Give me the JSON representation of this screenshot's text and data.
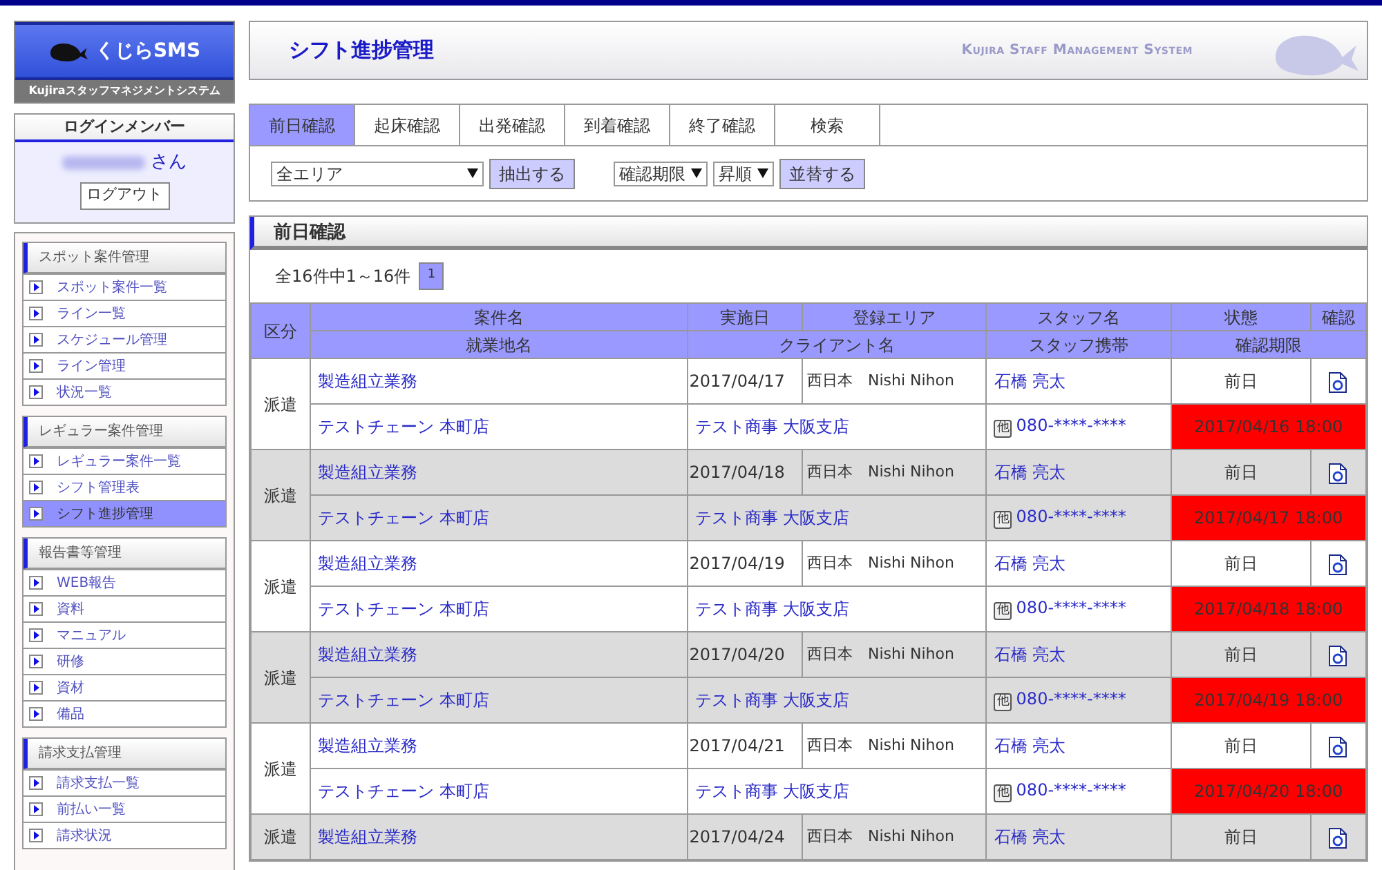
{
  "logo": {
    "title": "くじらSMS",
    "subtitle": "Kujiraスタッフマネジメントシステム"
  },
  "login": {
    "heading": "ログインメンバー",
    "honorific": "さん",
    "logout": "ログアウト"
  },
  "sidebar": [
    {
      "heading": "スポット案件管理",
      "items": [
        {
          "label": "スポット案件一覧",
          "selected": false
        },
        {
          "label": "ライン一覧",
          "selected": false
        },
        {
          "label": "スケジュール管理",
          "selected": false
        },
        {
          "label": "ライン管理",
          "selected": false
        },
        {
          "label": "状況一覧",
          "selected": false
        }
      ]
    },
    {
      "heading": "レギュラー案件管理",
      "items": [
        {
          "label": "レギュラー案件一覧",
          "selected": false
        },
        {
          "label": "シフト管理表",
          "selected": false
        },
        {
          "label": "シフト進捗管理",
          "selected": true
        }
      ]
    },
    {
      "heading": "報告書等管理",
      "items": [
        {
          "label": "WEB報告",
          "selected": false
        },
        {
          "label": "資料",
          "selected": false
        },
        {
          "label": "マニュアル",
          "selected": false
        },
        {
          "label": "研修",
          "selected": false
        },
        {
          "label": "資材",
          "selected": false
        },
        {
          "label": "備品",
          "selected": false
        }
      ]
    },
    {
      "heading": "請求支払管理",
      "items": [
        {
          "label": "請求支払一覧",
          "selected": false
        },
        {
          "label": "前払い一覧",
          "selected": false
        },
        {
          "label": "請求状況",
          "selected": false
        }
      ]
    }
  ],
  "header": {
    "title": "シフト進捗管理",
    "tagline": "Kujira Staff Management System"
  },
  "tabs": [
    {
      "label": "前日確認",
      "selected": true
    },
    {
      "label": "起床確認",
      "selected": false
    },
    {
      "label": "出発確認",
      "selected": false
    },
    {
      "label": "到着確認",
      "selected": false
    },
    {
      "label": "終了確認",
      "selected": false
    },
    {
      "label": "検索",
      "selected": false
    }
  ],
  "filters": {
    "area": "全エリア",
    "extract": "抽出する",
    "sort_key": "確認期限",
    "sort_order": "昇順",
    "sort": "並替する"
  },
  "section": {
    "title": "前日確認",
    "count": "全16件中1～16件",
    "pages": [
      {
        "label": "1",
        "selected": true
      }
    ]
  },
  "table": {
    "header_1": [
      "区分",
      "案件名",
      "実施日",
      "登録エリア",
      "スタッフ名",
      "状態",
      "確認"
    ],
    "header_2": [
      "就業地名",
      "クライアント名",
      "スタッフ携帯",
      "確認期限"
    ],
    "rows": [
      {
        "type": "派遣",
        "job": "製造組立業務",
        "date": "2017/04/17",
        "area": "西日本　Nishi Nihon",
        "staff": "石橋 亮太",
        "status": "前日",
        "site": "テストチェーン 本町店",
        "client": "テスト商事 大阪支店",
        "phone_tag": "他",
        "phone": "080-****-****",
        "deadline": "2017/04/16 18:00",
        "overdue": true
      },
      {
        "type": "派遣",
        "job": "製造組立業務",
        "date": "2017/04/18",
        "area": "西日本　Nishi Nihon",
        "staff": "石橋 亮太",
        "status": "前日",
        "site": "テストチェーン 本町店",
        "client": "テスト商事 大阪支店",
        "phone_tag": "他",
        "phone": "080-****-****",
        "deadline": "2017/04/17 18:00",
        "overdue": true
      },
      {
        "type": "派遣",
        "job": "製造組立業務",
        "date": "2017/04/19",
        "area": "西日本　Nishi Nihon",
        "staff": "石橋 亮太",
        "status": "前日",
        "site": "テストチェーン 本町店",
        "client": "テスト商事 大阪支店",
        "phone_tag": "他",
        "phone": "080-****-****",
        "deadline": "2017/04/18 18:00",
        "overdue": true
      },
      {
        "type": "派遣",
        "job": "製造組立業務",
        "date": "2017/04/20",
        "area": "西日本　Nishi Nihon",
        "staff": "石橋 亮太",
        "status": "前日",
        "site": "テストチェーン 本町店",
        "client": "テスト商事 大阪支店",
        "phone_tag": "他",
        "phone": "080-****-****",
        "deadline": "2017/04/19 18:00",
        "overdue": true
      },
      {
        "type": "派遣",
        "job": "製造組立業務",
        "date": "2017/04/21",
        "area": "西日本　Nishi Nihon",
        "staff": "石橋 亮太",
        "status": "前日",
        "site": "テストチェーン 本町店",
        "client": "テスト商事 大阪支店",
        "phone_tag": "他",
        "phone": "080-****-****",
        "deadline": "2017/04/20 18:00",
        "overdue": true
      },
      {
        "type": "派遣",
        "job": "製造組立業務",
        "date": "2017/04/24",
        "area": "西日本　Nishi Nihon",
        "staff": "石橋 亮太",
        "status": "前日"
      }
    ]
  }
}
